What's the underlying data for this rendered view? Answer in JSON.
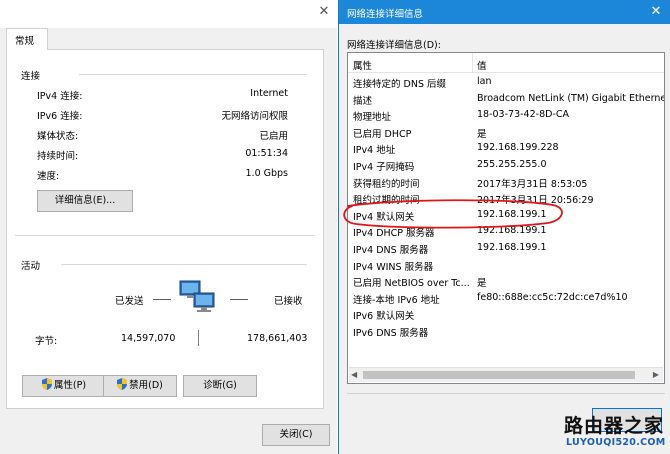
{
  "left": {
    "tab": "常规",
    "connection": {
      "title": "连接",
      "rows": [
        {
          "label": "IPv4 连接:",
          "value": "Internet"
        },
        {
          "label": "IPv6 连接:",
          "value": "无网络访问权限"
        },
        {
          "label": "媒体状态:",
          "value": "已启用"
        },
        {
          "label": "持续时间:",
          "value": "01:51:34"
        },
        {
          "label": "速度:",
          "value": "1.0 Gbps"
        }
      ],
      "details_button": "详细信息(E)..."
    },
    "activity": {
      "title": "活动",
      "sent_label": "已发送",
      "received_label": "已接收",
      "bytes_label": "字节:",
      "sent_value": "14,597,070",
      "received_value": "178,661,403"
    },
    "buttons": {
      "properties": "属性(P)",
      "disable": "禁用(D)",
      "diagnose": "诊断(G)",
      "close": "关闭(C)"
    }
  },
  "right": {
    "title": "网络连接详细信息",
    "list_label": "网络连接详细信息(D):",
    "columns": {
      "property": "属性",
      "value": "值"
    },
    "rows": [
      {
        "property": "连接特定的 DNS 后缀",
        "value": "lan"
      },
      {
        "property": "描述",
        "value": "Broadcom NetLink (TM) Gigabit Etherne"
      },
      {
        "property": "物理地址",
        "value": "18-03-73-42-8D-CA"
      },
      {
        "property": "已启用 DHCP",
        "value": "是"
      },
      {
        "property": "IPv4 地址",
        "value": "192.168.199.228"
      },
      {
        "property": "IPv4 子网掩码",
        "value": "255.255.255.0"
      },
      {
        "property": "获得租约的时间",
        "value": "2017年3月31日 8:53:05"
      },
      {
        "property": "租约过期的时间",
        "value": "2017年3月31日 20:56:29"
      },
      {
        "property": "IPv4 默认网关",
        "value": "192.168.199.1"
      },
      {
        "property": "IPv4 DHCP 服务器",
        "value": "192.168.199.1"
      },
      {
        "property": "IPv4 DNS 服务器",
        "value": "192.168.199.1"
      },
      {
        "property": "IPv4 WINS 服务器",
        "value": ""
      },
      {
        "property": "已启用 NetBIOS over Tc...",
        "value": "是"
      },
      {
        "property": "连接-本地 IPv6 地址",
        "value": "fe80::688e:cc5c:72dc:ce7d%10"
      },
      {
        "property": "IPv6 默认网关",
        "value": ""
      },
      {
        "property": "IPv6 DNS 服务器",
        "value": ""
      }
    ]
  },
  "watermark": {
    "title": "路由器之家",
    "url": "LUYOUQI520.COM"
  },
  "colors": {
    "titlebar": "#1c87d8",
    "highlight_ellipse": "#e0151b",
    "watermark_url": "#1c5fb4"
  }
}
